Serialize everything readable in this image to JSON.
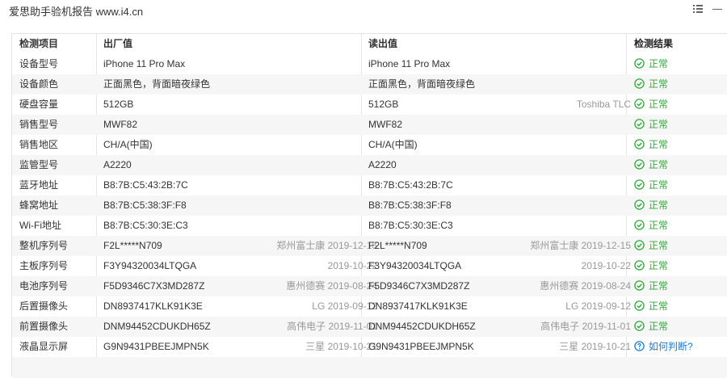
{
  "window": {
    "title": "爱思助手验机报告 www.i4.cn"
  },
  "table": {
    "headers": {
      "item": "检测项目",
      "factory": "出厂值",
      "read": "读出值",
      "result": "检测结果"
    },
    "rows": [
      {
        "item": "设备型号",
        "factory": "iPhone 11 Pro Max",
        "factory_note": "",
        "read": "iPhone 11 Pro Max",
        "read_note": "",
        "result": "正常",
        "status": "ok"
      },
      {
        "item": "设备颜色",
        "factory": "正面黑色，背面暗夜绿色",
        "factory_note": "",
        "read": "正面黑色，背面暗夜绿色",
        "read_note": "",
        "result": "正常",
        "status": "ok"
      },
      {
        "item": "硬盘容量",
        "factory": "512GB",
        "factory_note": "",
        "read": "512GB",
        "read_note": "Toshiba TLC",
        "result": "正常",
        "status": "ok"
      },
      {
        "item": "销售型号",
        "factory": "MWF82",
        "factory_note": "",
        "read": "MWF82",
        "read_note": "",
        "result": "正常",
        "status": "ok"
      },
      {
        "item": "销售地区",
        "factory": "CH/A(中国)",
        "factory_note": "",
        "read": "CH/A(中国)",
        "read_note": "",
        "result": "正常",
        "status": "ok"
      },
      {
        "item": "监管型号",
        "factory": "A2220",
        "factory_note": "",
        "read": "A2220",
        "read_note": "",
        "result": "正常",
        "status": "ok"
      },
      {
        "item": "蓝牙地址",
        "factory": "B8:7B:C5:43:2B:7C",
        "factory_note": "",
        "read": "B8:7B:C5:43:2B:7C",
        "read_note": "",
        "result": "正常",
        "status": "ok"
      },
      {
        "item": "蜂窝地址",
        "factory": "B8:7B:C5:38:3F:F8",
        "factory_note": "",
        "read": "B8:7B:C5:38:3F:F8",
        "read_note": "",
        "result": "正常",
        "status": "ok"
      },
      {
        "item": "Wi-Fi地址",
        "factory": "B8:7B:C5:30:3E:C3",
        "factory_note": "",
        "read": "B8:7B:C5:30:3E:C3",
        "read_note": "",
        "result": "正常",
        "status": "ok"
      },
      {
        "item": "整机序列号",
        "factory": "F2L*****N709",
        "factory_note": "郑州富士康 2019-12-15",
        "read": "F2L*****N709",
        "read_note": "郑州富士康 2019-12-15",
        "result": "正常",
        "status": "ok"
      },
      {
        "item": "主板序列号",
        "factory": "F3Y94320034LTQGA",
        "factory_note": "2019-10-22",
        "read": "F3Y94320034LTQGA",
        "read_note": "2019-10-22",
        "result": "正常",
        "status": "ok"
      },
      {
        "item": "电池序列号",
        "factory": "F5D9346C7X3MD287Z",
        "factory_note": "惠州德赛 2019-08-24",
        "read": "F5D9346C7X3MD287Z",
        "read_note": "惠州德赛 2019-08-24",
        "result": "正常",
        "status": "ok"
      },
      {
        "item": "后置摄像头",
        "factory": "DN8937417KLK91K3E",
        "factory_note": "LG 2019-09-12",
        "read": "DN8937417KLK91K3E",
        "read_note": "LG 2019-09-12",
        "result": "正常",
        "status": "ok"
      },
      {
        "item": "前置摄像头",
        "factory": "DNM94452CDUKDH65Z",
        "factory_note": "高伟电子 2019-11-01",
        "read": "DNM94452CDUKDH65Z",
        "read_note": "高伟电子 2019-11-01",
        "result": "正常",
        "status": "ok"
      },
      {
        "item": "液晶显示屏",
        "factory": "G9N9431PBEEJMPN5K",
        "factory_note": "三星 2019-10-21",
        "read": "G9N9431PBEEJMPN5K",
        "read_note": "三星 2019-10-21",
        "result": "如何判断?",
        "status": "help"
      }
    ]
  },
  "colors": {
    "ok_green": "#2eaa3a",
    "link_blue": "#1c7ad6",
    "row_alt": "#f6f6f6",
    "note_gray": "#999999"
  },
  "icons": {
    "ok": "check-circle-icon",
    "help": "question-circle-icon",
    "menu": "list-menu-icon",
    "minimize": "minimize-icon"
  }
}
